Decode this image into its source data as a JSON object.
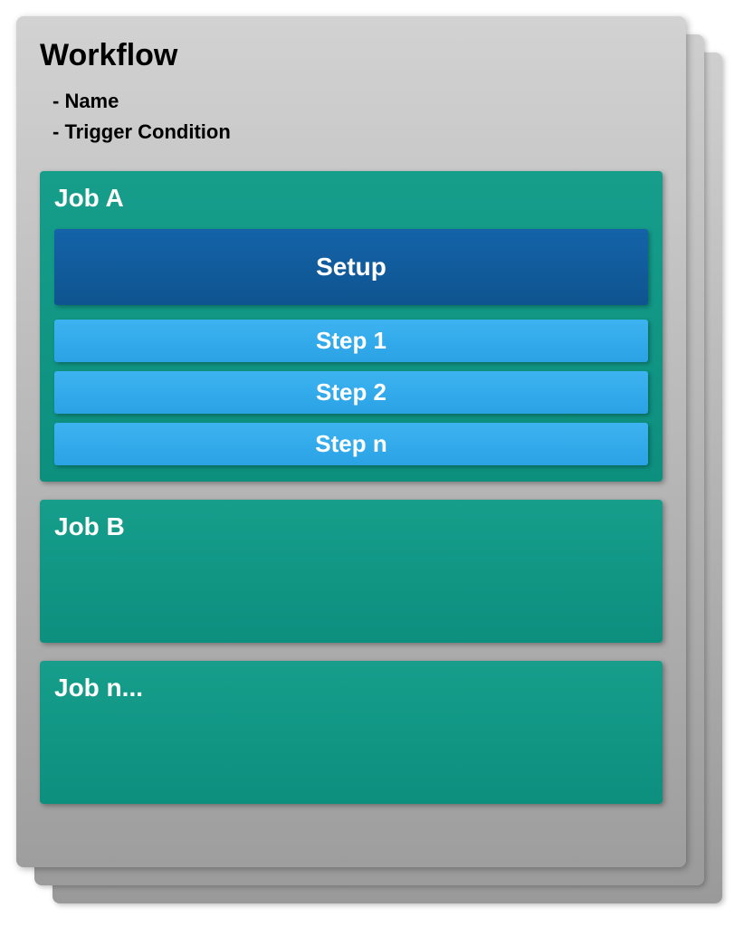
{
  "workflow": {
    "title": "Workflow",
    "attributes": [
      "- Name",
      "- Trigger Condition"
    ]
  },
  "jobs": {
    "a": {
      "title": "Job A",
      "setup": "Setup",
      "steps": [
        "Step 1",
        "Step 2",
        "Step n"
      ]
    },
    "b": {
      "title": "Job B"
    },
    "n": {
      "title": "Job n..."
    }
  },
  "colors": {
    "card_bg_top": "#d2d2d2",
    "card_bg_bottom": "#9e9e9e",
    "job_bg": "#169e8b",
    "setup_bg": "#1463a8",
    "step_bg": "#3db3f1"
  }
}
